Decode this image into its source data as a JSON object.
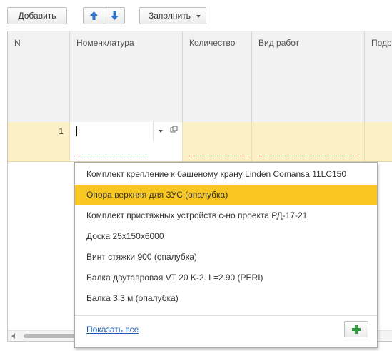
{
  "toolbar": {
    "add_label": "Добавить",
    "fill_label": "Заполнить",
    "up_icon": "arrow-up-icon",
    "down_icon": "arrow-down-icon",
    "accent_color": "#2a73c8"
  },
  "table": {
    "columns": [
      "N",
      "Номенклатура",
      "Количество",
      "Вид работ",
      "Подр"
    ],
    "rows": [
      {
        "n": "1",
        "nomenclature": "",
        "quantity": "",
        "work_type": "",
        "division": ""
      }
    ],
    "selected_row_color": "#fbf0c6"
  },
  "dropdown": {
    "items": [
      "Комплект крепление к башеному крану Linden Comansa 11LC150",
      "Опора верхняя для ЗУС (опалубка)",
      "Комплект пристяжных устройств с-но проекта РД-17-21",
      "Доска 25х150х6000",
      "Винт стяжки 900 (опалубка)",
      "Балка двутавровая VT 20 K-2. L=2.90 (PERI)",
      "Балка 3,3 м (опалубка)"
    ],
    "selected_index": 1,
    "highlight_color": "#f7c623",
    "show_all_label": "Показать все",
    "create_icon": "plus-icon"
  }
}
